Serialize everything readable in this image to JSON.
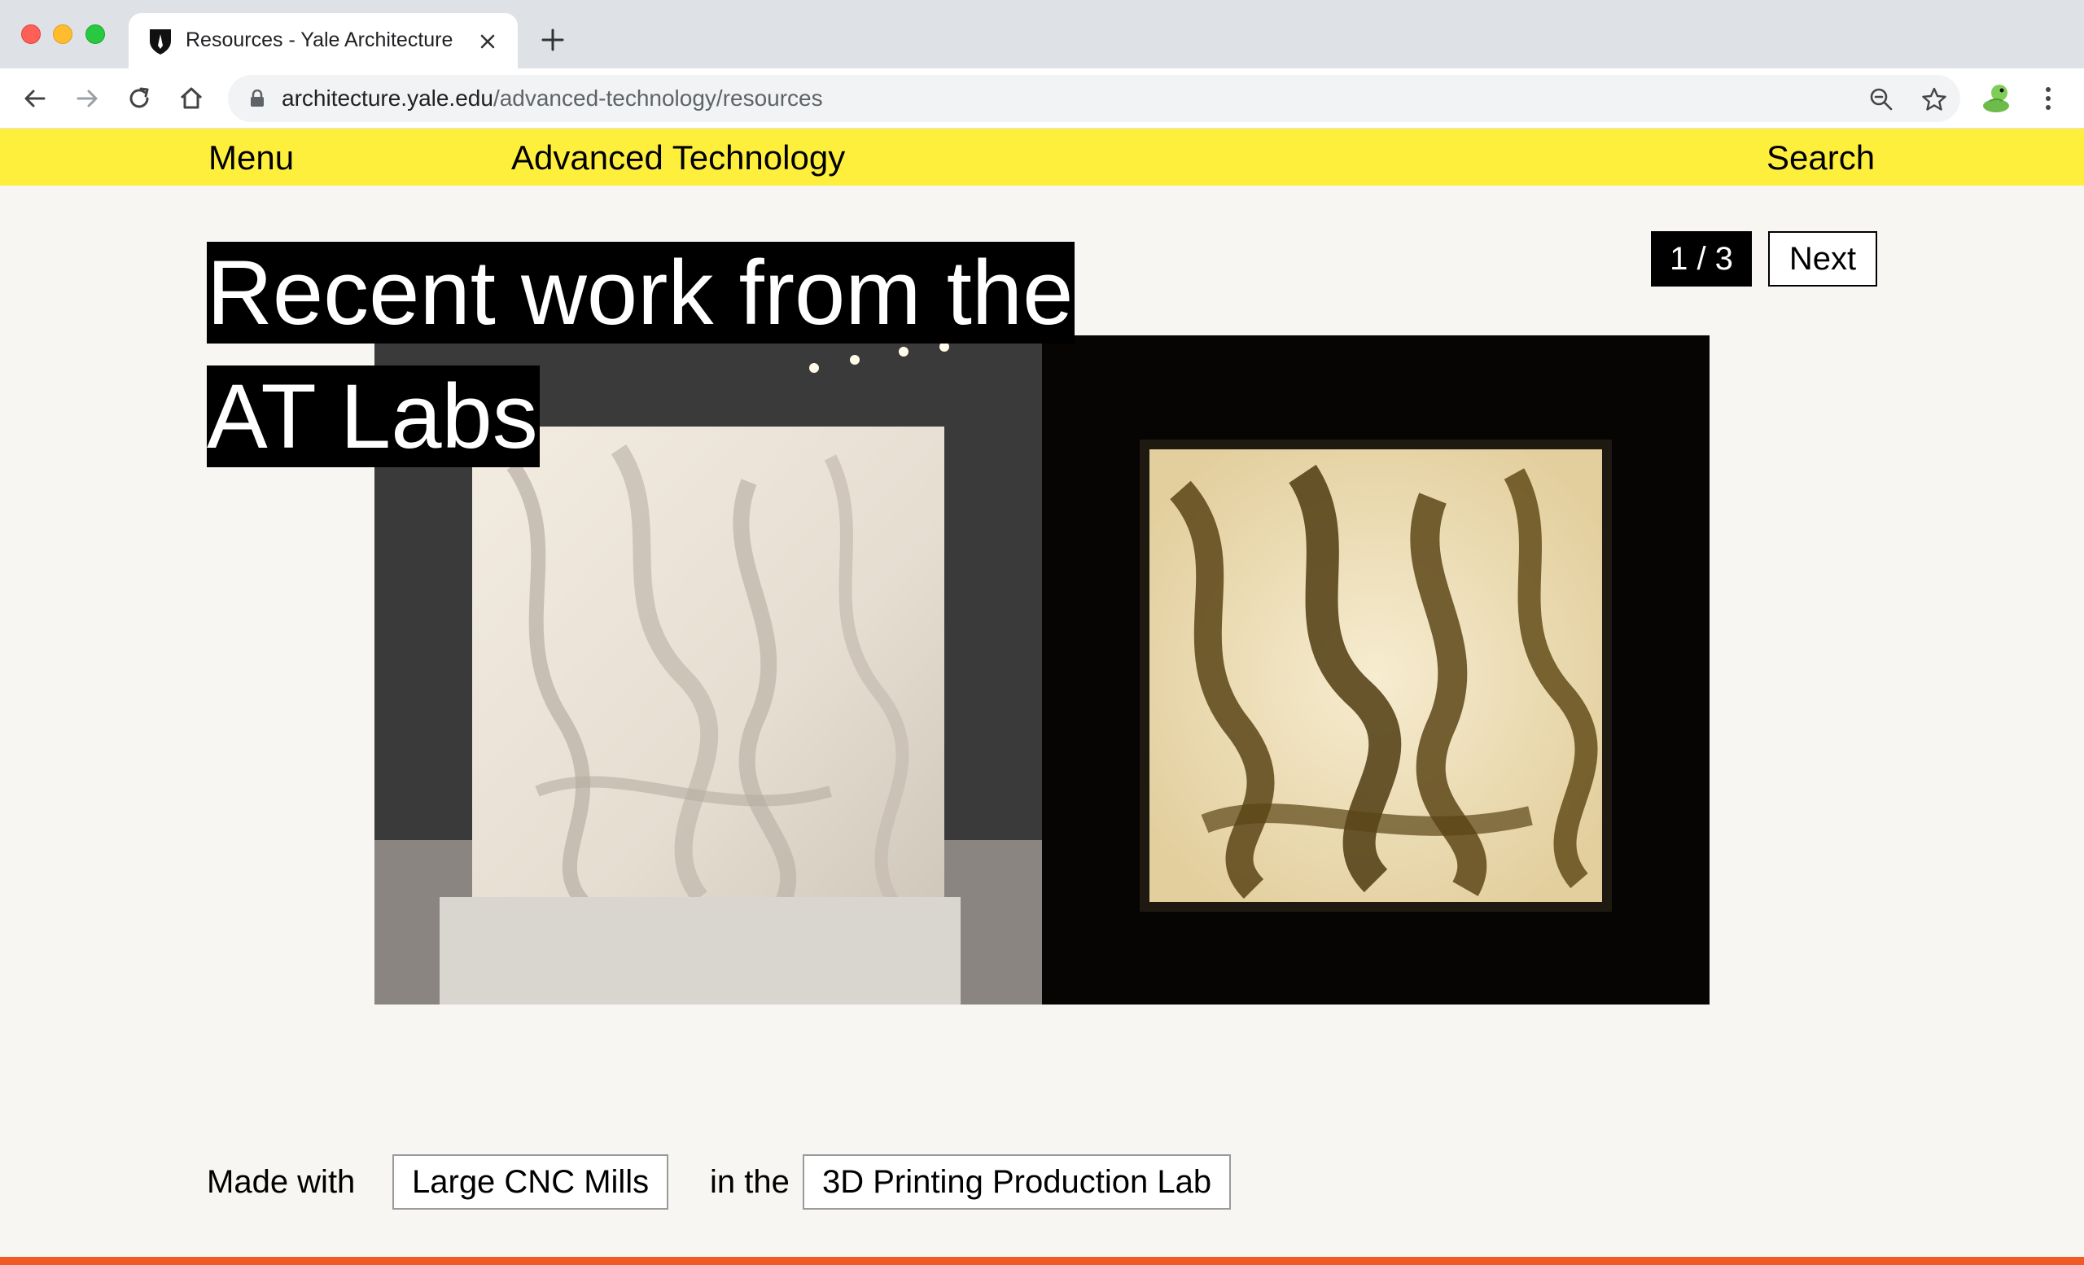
{
  "browser": {
    "tab_title": "Resources - Yale Architecture",
    "url_domain": "architecture.yale.edu",
    "url_path": "/advanced-technology/resources"
  },
  "header": {
    "menu_label": "Menu",
    "section_title": "Advanced Technology",
    "search_label": "Search"
  },
  "hero": {
    "headline_line1": "Recent work from the",
    "headline_line2": "AT Labs",
    "counter": "1 / 3",
    "next_label": "Next"
  },
  "caption": {
    "prefix": "Made with",
    "tool_link": "Large CNC Mills",
    "middle": "in the",
    "lab_link": "3D Printing Production Lab"
  },
  "colors": {
    "header_bg": "#ffef3d",
    "page_bg": "#f7f6f2",
    "accent_bar": "#f05a24"
  }
}
